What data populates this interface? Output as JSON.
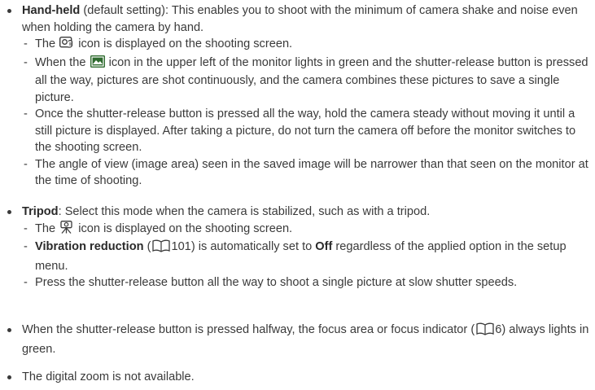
{
  "b1": {
    "term": "Hand-held",
    "rest": " (default setting): This enables you to shoot with the minimum of camera shake and noise even when holding the camera by hand.",
    "s1_pre": "The ",
    "s1_post": " icon is displayed on the shooting screen.",
    "s2_pre": "When the ",
    "s2_post": " icon in the upper left of the monitor lights in green and the shutter-release button is pressed all the way, pictures are shot continuously, and the camera combines these pictures to save a single picture.",
    "s3": "Once the shutter-release button is pressed all the way, hold the camera steady without moving it until a still picture is displayed. After taking a picture, do not turn the camera off before the monitor switches to the shooting screen.",
    "s4": "The angle of view (image area) seen in the saved image will be narrower than that seen on the monitor at the time of shooting."
  },
  "b2": {
    "term": "Tripod",
    "rest": ": Select this mode when the camera is stabilized, such as with a tripod.",
    "s1_pre": "The ",
    "s1_post": " icon is displayed on the shooting screen.",
    "s2_term": "Vibration reduction",
    "s2_page": "101",
    "s2_mid": ") is automatically set to ",
    "s2_off": "Off",
    "s2_post": " regardless of the applied option in the setup menu.",
    "s3": "Press the shutter-release button all the way to shoot a single picture at slow shutter speeds."
  },
  "b3": {
    "pre": "When the shutter-release button is pressed halfway, the focus area or focus indicator (",
    "page": "6",
    "post": ") always lights in green."
  },
  "b4": {
    "text": "The digital zoom is not available."
  },
  "dash": "-",
  "open_paren": " (",
  "colors": {
    "text": "#3a3a3a",
    "icon_green": "#2f6b2f"
  }
}
